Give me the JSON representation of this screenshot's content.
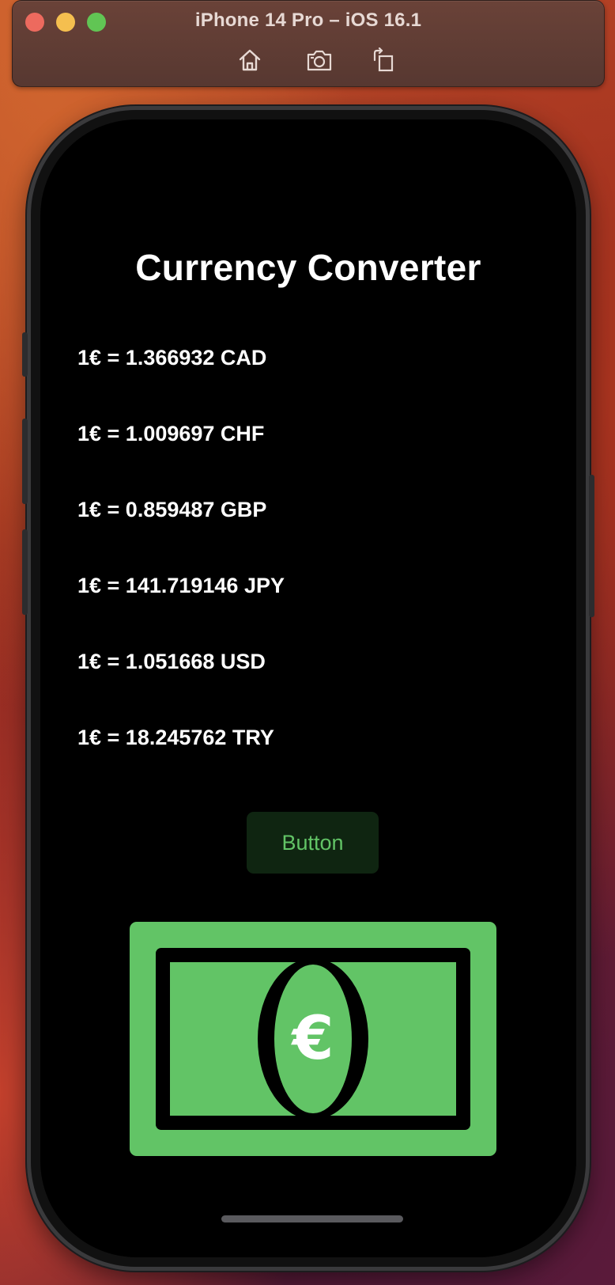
{
  "window": {
    "title": "iPhone 14 Pro – iOS 16.1",
    "controls": [
      "close",
      "minimize",
      "zoom"
    ],
    "toolbar": [
      {
        "name": "home-icon"
      },
      {
        "name": "screenshot-icon"
      },
      {
        "name": "rotate-icon"
      }
    ]
  },
  "app": {
    "title": "Currency Converter",
    "rates": [
      "1€ = 1.366932 CAD",
      "1€ = 1.009697 CHF",
      "1€ = 0.859487 GBP",
      "1€ = 141.719146 JPY",
      "1€ = 1.051668 USD",
      "1€ = 18.245762 TRY"
    ],
    "button_label": "Button",
    "illustration": {
      "icon": "euro-banknote-icon",
      "symbol": "€",
      "color": "#62c466"
    }
  },
  "colors": {
    "accent_green": "#62c466",
    "button_bg": "#0f2511",
    "screen_bg": "#000000",
    "text": "#ffffff"
  }
}
